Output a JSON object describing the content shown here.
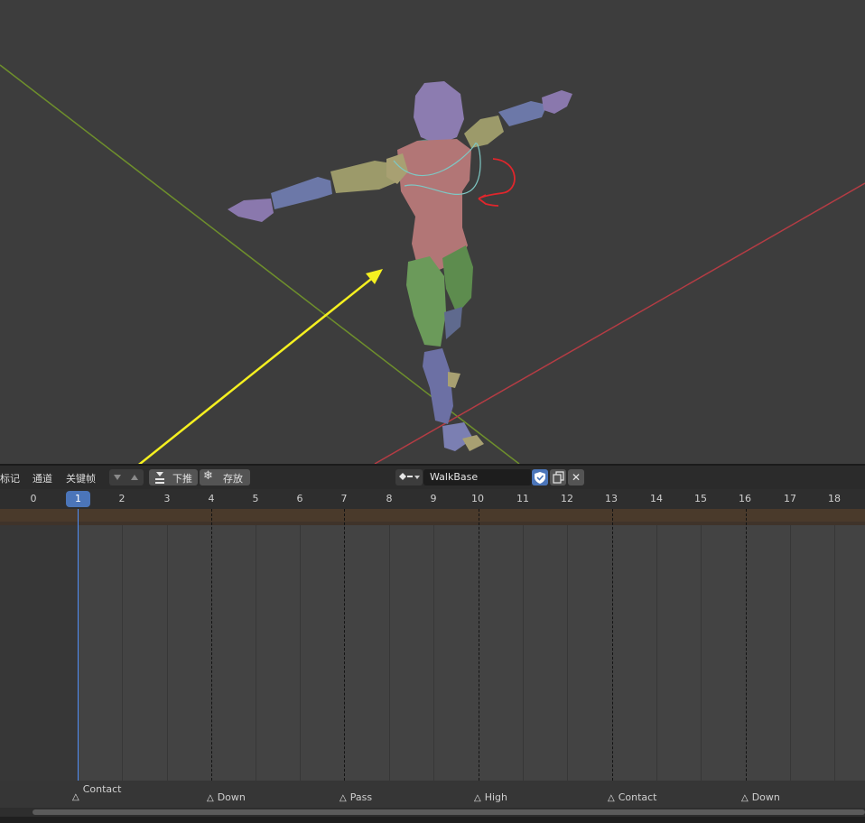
{
  "header": {
    "menus": [
      "标记",
      "通道",
      "关键帧"
    ],
    "push_down_label": "下推",
    "stash_label": "存放",
    "action_name": "WalkBase"
  },
  "timeline": {
    "current_frame": "1",
    "frame_numbers": [
      "0",
      "2",
      "3",
      "4",
      "5",
      "6",
      "7",
      "8",
      "9",
      "10",
      "11",
      "12",
      "13",
      "14",
      "15",
      "16",
      "17",
      "18"
    ]
  },
  "markers": [
    {
      "frame": 1,
      "label": "Contact"
    },
    {
      "frame": 4,
      "label": "Down"
    },
    {
      "frame": 7,
      "label": "Pass"
    },
    {
      "frame": 10,
      "label": "High"
    },
    {
      "frame": 13,
      "label": "Contact"
    },
    {
      "frame": 16,
      "label": "Down"
    }
  ],
  "icons": {
    "filter": "filter-down-up-icon",
    "push_down": "push-down-icon",
    "stash": "snowflake-icon",
    "action_type": "action-icon",
    "fake_user": "shield-icon",
    "duplicate": "duplicate-icon",
    "unlink": "close-icon"
  },
  "colors": {
    "playhead": "#4f8ef5",
    "current_frame_badge": "#4b75b9",
    "x_axis": "#b43c44",
    "y_axis": "#6e8f2c",
    "annotation_arrow": "#f5f020",
    "head": "#8c7cb0",
    "torso": "#b27676",
    "legs": "#6b9a5a",
    "arms_upper": "#9c9a6a",
    "arms_lower": "#6c78a8"
  }
}
